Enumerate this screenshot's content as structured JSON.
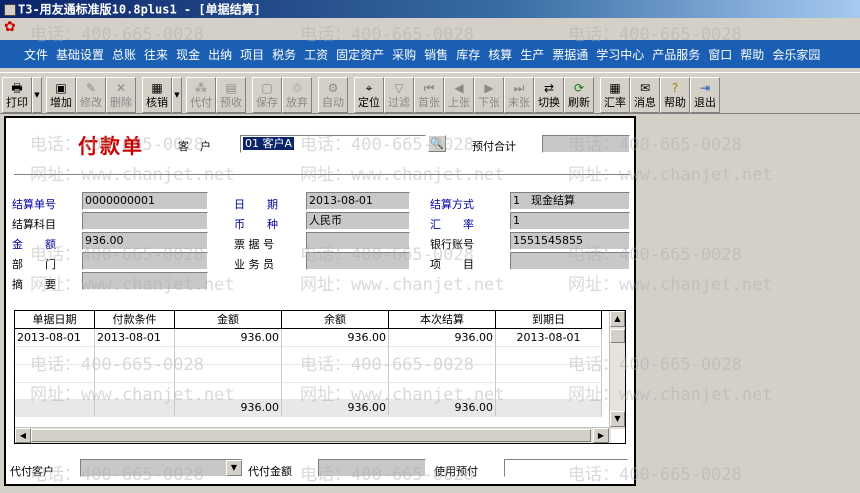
{
  "window": {
    "title": "T3-用友通标准版10.8plus1 - [单据结算]"
  },
  "menu": [
    "文件",
    "基础设置",
    "总账",
    "往来",
    "现金",
    "出纳",
    "项目",
    "税务",
    "工资",
    "固定资产",
    "采购",
    "销售",
    "库存",
    "核算",
    "生产",
    "票据通",
    "学习中心",
    "产品服务",
    "窗口",
    "帮助",
    "会乐家园"
  ],
  "toolbar": [
    {
      "label": "打印",
      "icon": "print-icon",
      "enabled": true,
      "dropdown": true
    },
    {
      "label": "增加",
      "icon": "add-icon",
      "enabled": true
    },
    {
      "label": "修改",
      "icon": "edit-icon",
      "enabled": false
    },
    {
      "label": "删除",
      "icon": "delete-icon",
      "enabled": false
    },
    {
      "label": "核销",
      "icon": "verify-icon",
      "enabled": true,
      "dropdown": true
    },
    {
      "label": "代付",
      "icon": "proxy-pay-icon",
      "enabled": false
    },
    {
      "label": "预收",
      "icon": "prepay-icon",
      "enabled": false
    },
    {
      "label": "保存",
      "icon": "save-icon",
      "enabled": false
    },
    {
      "label": "放弃",
      "icon": "discard-icon",
      "enabled": false
    },
    {
      "label": "自动",
      "icon": "auto-icon",
      "enabled": false
    },
    {
      "label": "定位",
      "icon": "locate-icon",
      "enabled": true
    },
    {
      "label": "过滤",
      "icon": "filter-icon",
      "enabled": false
    },
    {
      "label": "首张",
      "icon": "first-icon",
      "enabled": false
    },
    {
      "label": "上张",
      "icon": "prev-icon",
      "enabled": false
    },
    {
      "label": "下张",
      "icon": "next-icon",
      "enabled": false
    },
    {
      "label": "末张",
      "icon": "last-icon",
      "enabled": false
    },
    {
      "label": "切换",
      "icon": "switch-icon",
      "enabled": true
    },
    {
      "label": "刷新",
      "icon": "refresh-icon",
      "enabled": true
    },
    {
      "label": "汇率",
      "icon": "rate-icon",
      "enabled": true
    },
    {
      "label": "消息",
      "icon": "message-icon",
      "enabled": true
    },
    {
      "label": "帮助",
      "icon": "help-icon",
      "enabled": true
    },
    {
      "label": "退出",
      "icon": "exit-icon",
      "enabled": true
    }
  ],
  "form": {
    "title": "付款单",
    "customer_label": "客　户",
    "customer_value": "01 客户A",
    "prepay_total_label": "预付合计",
    "prepay_total_value": "",
    "settle_no_label": "结算单号",
    "settle_no_value": "0000000001",
    "date_label": "日　　期",
    "date_value": "2013-08-01",
    "settle_method_label": "结算方式",
    "settle_method_value": "1　现金结算",
    "settle_subject_label": "结算科目",
    "settle_subject_value": "",
    "currency_label": "币　　种",
    "currency_value": "人民币",
    "exchange_rate_label": "汇　　率",
    "exchange_rate_value": "1",
    "amount_label": "金　　额",
    "amount_value": "936.00",
    "bill_no_label": "票 据 号",
    "bill_no_value": "",
    "bank_account_label": "银行账号",
    "bank_account_value": "1551545855",
    "dept_label": "部　　门",
    "dept_value": "",
    "salesperson_label": "业 务 员",
    "salesperson_value": "",
    "project_label": "项　　目",
    "project_value": "",
    "memo_label": "摘　　要",
    "memo_value": ""
  },
  "grid": {
    "columns": [
      "单据日期",
      "付款条件",
      "金额",
      "余额",
      "本次结算",
      "到期日"
    ],
    "rows": [
      [
        "2013-08-01",
        "2013-08-01",
        "936.00",
        "936.00",
        "936.00",
        "2013-08-01"
      ]
    ],
    "totals": [
      "",
      "",
      "936.00",
      "936.00",
      "936.00",
      ""
    ]
  },
  "footer": {
    "proxy_customer_label": "代付客户",
    "proxy_customer_value": "",
    "proxy_amount_label": "代付金额",
    "proxy_amount_value": "",
    "use_prepay_label": "使用预付",
    "use_prepay_value": ""
  },
  "watermark": {
    "phone": "电话：400-665-0028",
    "url": "网址：www.chanjet.net"
  },
  "colors": {
    "menu_bg": "#1a5fb4",
    "title_red": "#cc0000",
    "label_blue": "#0000a0",
    "field_gray": "#c8c8c8"
  }
}
